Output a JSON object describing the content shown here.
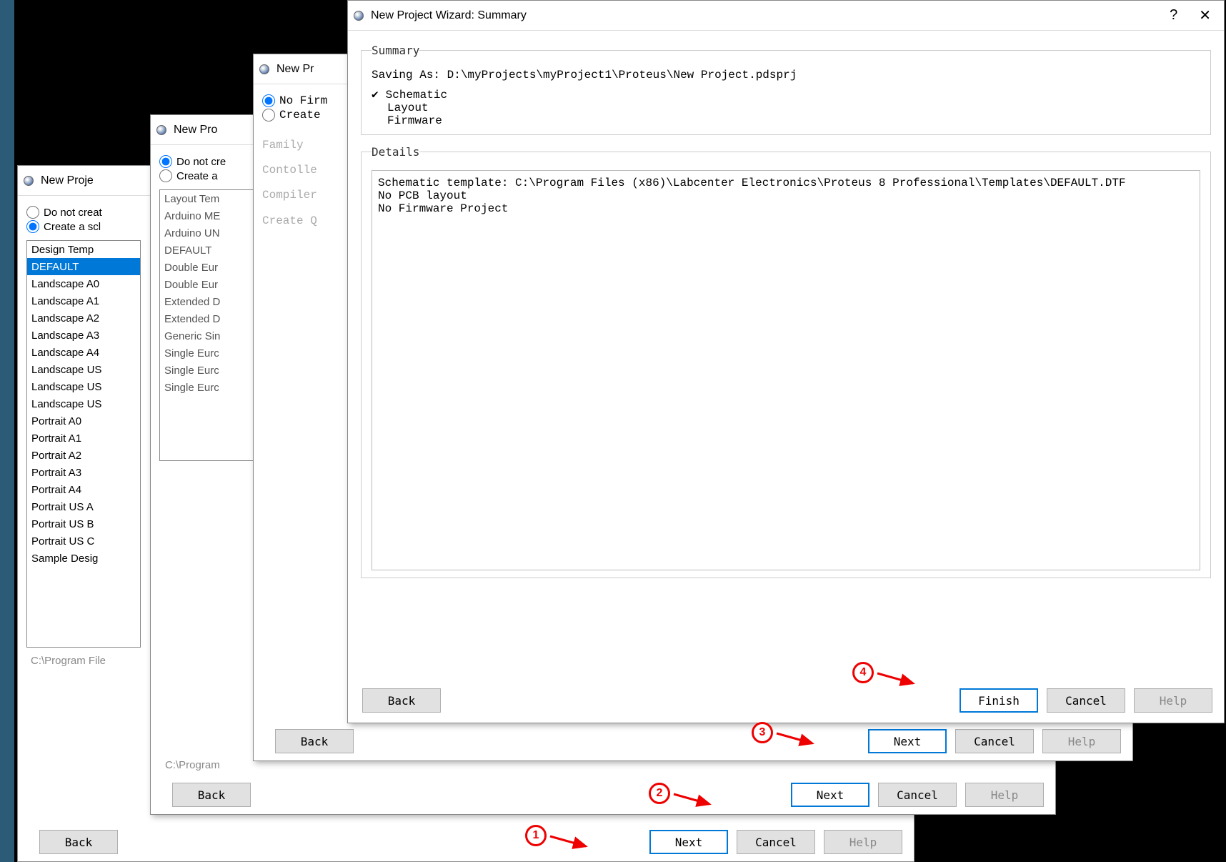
{
  "win1": {
    "title": "New Proje",
    "radios": {
      "opt1": "Do not creat",
      "opt2": "Create a scl"
    },
    "templates": [
      "Design Temp",
      "DEFAULT",
      "Landscape A0",
      "Landscape A1",
      "Landscape A2",
      "Landscape A3",
      "Landscape A4",
      "Landscape US",
      "Landscape US",
      "Landscape US",
      "Portrait A0",
      "Portrait A1",
      "Portrait A2",
      "Portrait A3",
      "Portrait A4",
      "Portrait US A",
      "Portrait US B",
      "Portrait US C",
      "Sample Desig"
    ],
    "path": "C:\\Program File",
    "back": "Back",
    "next": "Next",
    "cancel": "Cancel",
    "help": "Help"
  },
  "win2": {
    "title": "New Pro",
    "radios": {
      "opt1": "Do not cre",
      "opt2": "Create a"
    },
    "listlabel": "Layout Tem",
    "templates": [
      "Arduino ME",
      "Arduino UN",
      "DEFAULT",
      "Double Eur",
      "Double Eur",
      "Extended D",
      "Extended D",
      "Generic Sin",
      "Single Eurc",
      "Single Eurc",
      "Single Eurc"
    ],
    "path": "C:\\Program",
    "back": "Back",
    "next": "Next",
    "cancel": "Cancel",
    "help": "Help"
  },
  "win3": {
    "title": "New Pr",
    "radios": {
      "opt1": "No Firm",
      "opt2": "Create"
    },
    "fields": [
      "Family",
      "Contolle",
      "Compiler",
      "Create Q"
    ],
    "back": "Back",
    "next": "Next",
    "cancel": "Cancel",
    "help": "Help"
  },
  "win4": {
    "title": "New Project Wizard: Summary",
    "help_sym": "?",
    "close_sym": "✕",
    "summary_label": "Summary",
    "saving_as": "Saving As:  D:\\myProjects\\myProject1\\Proteus\\New Project.pdsprj",
    "items": {
      "schematic": "Schematic",
      "layout": "Layout",
      "firmware": "Firmware"
    },
    "details_label": "Details",
    "details_text": "Schematic template: C:\\Program Files (x86)\\Labcenter Electronics\\Proteus 8 Professional\\Templates\\DEFAULT.DTF\nNo PCB layout\nNo Firmware Project",
    "back": "Back",
    "finish": "Finish",
    "cancel": "Cancel",
    "help": "Help"
  },
  "anno": {
    "a1": "1",
    "a2": "2",
    "a3": "3",
    "a4": "4"
  }
}
